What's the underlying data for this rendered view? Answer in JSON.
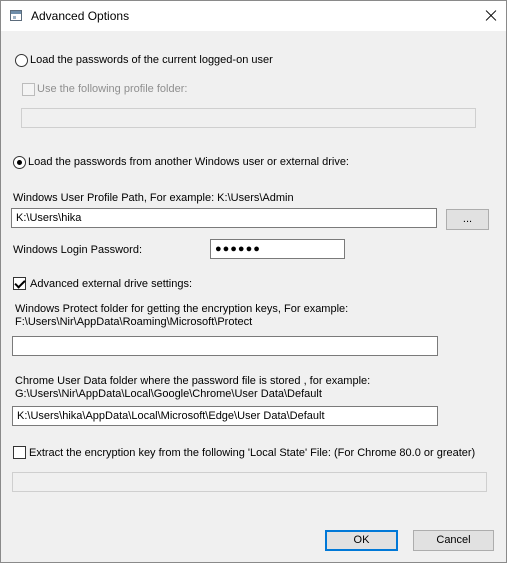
{
  "window": {
    "title": "Advanced Options",
    "close_icon": "close-icon"
  },
  "current_user": {
    "radio_label": "Load the passwords of the current logged-on user",
    "selected": false,
    "profile_checkbox_label": "Use the following profile folder:",
    "profile_checkbox_checked": false,
    "profile_folder_value": ""
  },
  "other_user": {
    "radio_label": "Load the passwords from another Windows user or external drive:",
    "selected": true,
    "profile_path_label": "Windows User Profile Path, For example: K:\\Users\\Admin",
    "profile_path_value": "K:\\Users\\hika",
    "browse_label": "...",
    "login_password_label": "Windows Login Password:",
    "login_password_value": "●●●●●●"
  },
  "advanced": {
    "checkbox_label": "Advanced external drive settings:",
    "checked": true,
    "protect_label_line1": "Windows Protect folder for getting the encryption keys, For example:",
    "protect_label_line2": "F:\\Users\\Nir\\AppData\\Roaming\\Microsoft\\Protect",
    "protect_value": "",
    "chrome_label_line1": "Chrome User Data folder where the password file is stored , for example:",
    "chrome_label_line2": "G:\\Users\\Nir\\AppData\\Local\\Google\\Chrome\\User Data\\Default",
    "chrome_value": "K:\\Users\\hika\\AppData\\Local\\Microsoft\\Edge\\User Data\\Default"
  },
  "local_state": {
    "checkbox_label": "Extract the encryption key from the following 'Local State' File: (For Chrome 80.0 or greater)",
    "checked": false,
    "value": ""
  },
  "buttons": {
    "ok": "OK",
    "cancel": "Cancel"
  }
}
